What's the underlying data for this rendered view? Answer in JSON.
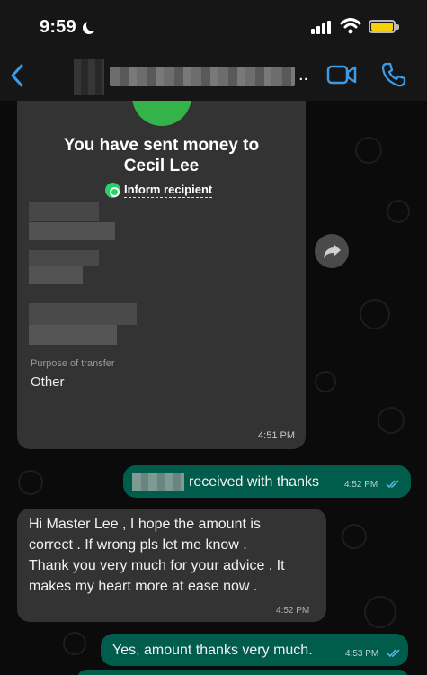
{
  "status_bar": {
    "time": "9:59"
  },
  "header": {
    "name_ellipsis": ".."
  },
  "payment_card": {
    "title_line1": "You have sent money to",
    "title_line2": "Cecil Lee",
    "inform_label": "Inform recipient",
    "purpose_label": "Purpose of transfer",
    "purpose_value": "Other",
    "time": "4:51 PM"
  },
  "messages": [
    {
      "direction": "out",
      "text": "received with thanks",
      "time": "4:52 PM",
      "status": "read"
    },
    {
      "direction": "in",
      "lines": [
        "Hi Master Lee , I hope the amount is",
        "correct . If wrong pls let me know .",
        "Thank you very much for your advice . It",
        "makes my heart more at ease now ."
      ],
      "time": "4:52 PM"
    },
    {
      "direction": "out",
      "text": "Yes, amount thanks very much.",
      "time": "4:53 PM",
      "status": "read"
    }
  ],
  "colors": {
    "background": "#0b0b0b",
    "bar": "#161616",
    "incoming_bubble": "#333333",
    "outgoing_bubble": "#005c4b",
    "accent_blue": "#3a9be6",
    "read_ticks": "#53bdeb",
    "success_green": "#33b34a",
    "battery": "#f6d10a"
  },
  "icons": [
    "moon-icon",
    "signal-icon",
    "wifi-icon",
    "battery-icon",
    "back-icon",
    "video-call-icon",
    "phone-call-icon",
    "check-icon",
    "whatsapp-icon",
    "forward-icon",
    "read-ticks-icon"
  ]
}
